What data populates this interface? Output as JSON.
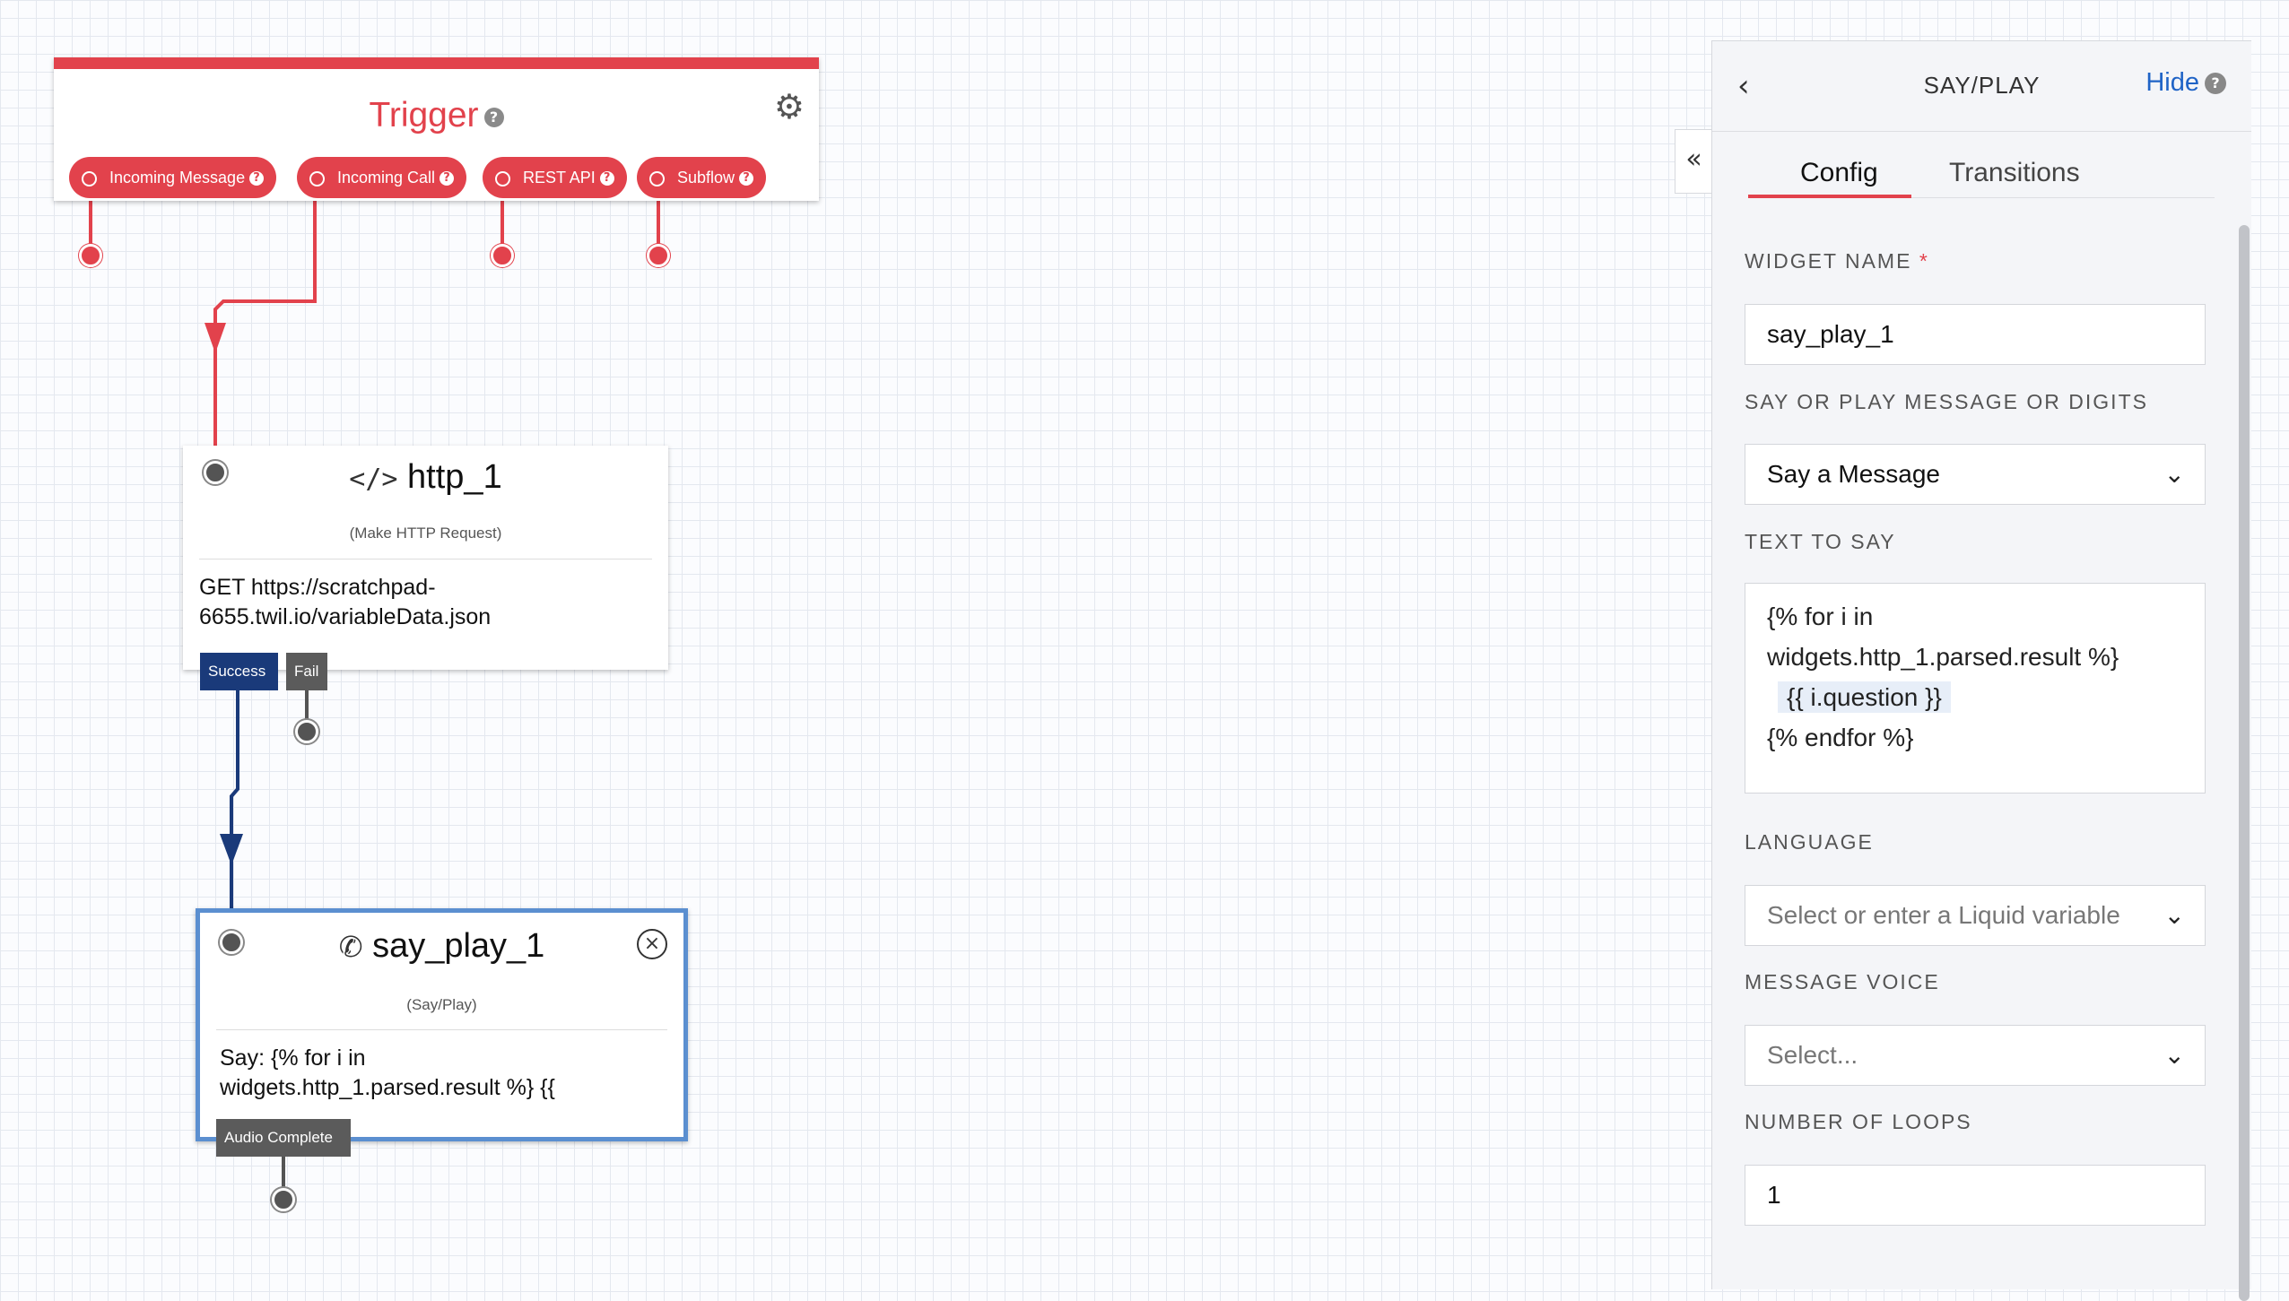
{
  "trigger": {
    "title": "Trigger",
    "gear_icon": "gear-icon",
    "pills": [
      {
        "label": "Incoming Message"
      },
      {
        "label": "Incoming Call"
      },
      {
        "label": "REST API"
      },
      {
        "label": "Subflow"
      }
    ]
  },
  "http_widget": {
    "name": "http_1",
    "type": "(Make HTTP Request)",
    "body_line1": "GET https://scratchpad-",
    "body_line2": "6655.twil.io/variableData.json",
    "success_label": "Success",
    "fail_label": "Fail"
  },
  "say_widget": {
    "name": "say_play_1",
    "type": "(Say/Play)",
    "body_line1": "Say: {% for i in",
    "body_line2": "widgets.http_1.parsed.result %} {{",
    "audio_complete_label": "Audio Complete"
  },
  "panel": {
    "title": "SAY/PLAY",
    "hide_label": "Hide",
    "tabs": [
      "Config",
      "Transitions"
    ],
    "widget_name_label": "WIDGET NAME",
    "widget_name_required": "*",
    "widget_name_value": "say_play_1",
    "say_or_play_label": "SAY OR PLAY MESSAGE OR DIGITS",
    "say_or_play_value": "Say a Message",
    "text_to_say_label": "TEXT TO SAY",
    "text_to_say_lines": [
      "{% for i in",
      "widgets.http_1.parsed.result %}",
      "{{ i.question }}",
      "{% endfor %}"
    ],
    "language_label": "LANGUAGE",
    "language_placeholder": "Select or enter a Liquid variable",
    "voice_label": "MESSAGE VOICE",
    "voice_placeholder": "Select...",
    "loops_label": "NUMBER OF LOOPS",
    "loops_value": "1"
  },
  "colors": {
    "trigger_red": "#e2424c",
    "success_blue": "#1a3a7a",
    "selected_border": "#5b8fd0",
    "link_blue": "#1f63c6"
  }
}
